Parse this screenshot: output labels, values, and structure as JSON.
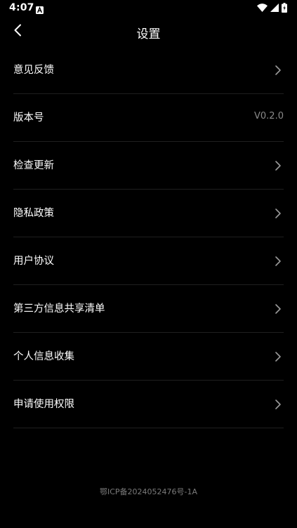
{
  "status_bar": {
    "time": "4:07",
    "notification_icon": "accessibility-a-icon",
    "icons": [
      "wifi-icon",
      "cellular-signal-icon",
      "battery-charging-icon"
    ]
  },
  "header": {
    "title": "设置",
    "back_icon": "chevron-left-icon"
  },
  "settings": {
    "items": [
      {
        "label": "意见反馈",
        "value": "",
        "chevron": true
      },
      {
        "label": "版本号",
        "value": "V0.2.0",
        "chevron": false
      },
      {
        "label": "检查更新",
        "value": "",
        "chevron": true
      },
      {
        "label": "隐私政策",
        "value": "",
        "chevron": true
      },
      {
        "label": "用户协议",
        "value": "",
        "chevron": true
      },
      {
        "label": "第三方信息共享清单",
        "value": "",
        "chevron": true
      },
      {
        "label": "个人信息收集",
        "value": "",
        "chevron": true
      },
      {
        "label": "申请使用权限",
        "value": "",
        "chevron": true
      }
    ]
  },
  "footer": {
    "icp": "鄂ICP备2024052476号-1A"
  },
  "colors": {
    "background": "#000000",
    "text": "#ffffff",
    "secondary_text": "#8a8a8a",
    "divider": "#1f1f1f",
    "chevron": "#9a9a9a"
  }
}
